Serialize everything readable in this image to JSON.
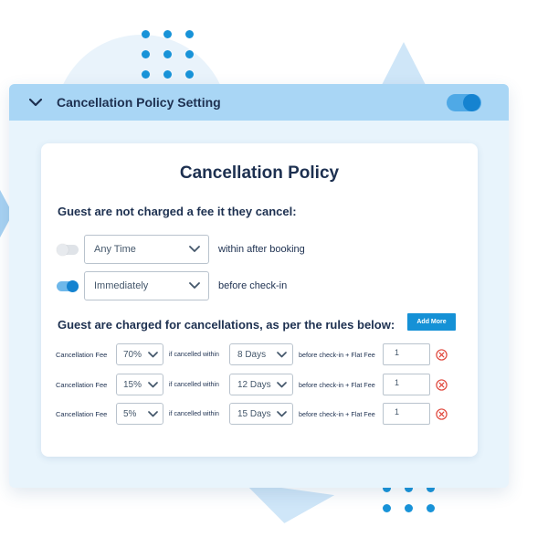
{
  "header": {
    "title": "Cancellation Policy Setting",
    "enabled": true
  },
  "card": {
    "title": "Cancellation Policy",
    "free_section": {
      "heading": "Guest are not charged a fee it they cancel:",
      "rows": [
        {
          "enabled": false,
          "selected": "Any Time",
          "suffix": "within after booking"
        },
        {
          "enabled": true,
          "selected": "Immediately",
          "suffix": "before check-in"
        }
      ]
    },
    "charged_section": {
      "heading": "Guest are charged for cancellations, as per the rules below:",
      "add_more_label": "Add More",
      "rows": [
        {
          "label": "Cancellation Fee",
          "percent": "70%",
          "if_text": "if cancelled within",
          "days": "8 Days",
          "before_text": "before check-in + Flat Fee",
          "flat_fee": "1"
        },
        {
          "label": "Cancellation Fee",
          "percent": "15%",
          "if_text": "if cancelled within",
          "days": "12 Days",
          "before_text": "before check-in + Flat Fee",
          "flat_fee": "1"
        },
        {
          "label": "Cancellation Fee",
          "percent": "5%",
          "if_text": "if cancelled within",
          "days": "15 Days",
          "before_text": "before check-in + Flat Fee",
          "flat_fee": "1"
        }
      ]
    }
  },
  "icons": {
    "collapse": "chevron-down-icon",
    "dropdown": "chevron-down-icon",
    "remove": "remove-circle-icon"
  },
  "colors": {
    "accent": "#1591d6",
    "header_bg": "#a9d6f5",
    "panel_bg": "#e8f4fc",
    "remove": "#e0453a",
    "text": "#1d3050"
  }
}
